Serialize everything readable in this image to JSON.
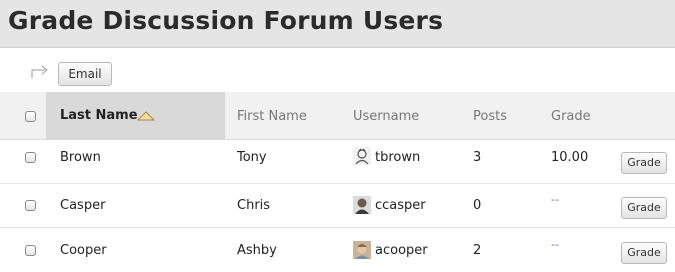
{
  "page": {
    "title": "Grade Discussion Forum Users"
  },
  "toolbar": {
    "email_label": "Email"
  },
  "table": {
    "headers": {
      "last_name": "Last Name",
      "first_name": "First Name",
      "username": "Username",
      "posts": "Posts",
      "grade": "Grade"
    },
    "sort": {
      "column": "last_name",
      "direction": "ascending"
    },
    "rows": [
      {
        "last_name": "Brown",
        "first_name": "Tony",
        "username": "tbrown",
        "avatar_icon": "user-avatar-sketch-icon",
        "posts": "3",
        "grade": "10.00",
        "action": "Grade"
      },
      {
        "last_name": "Casper",
        "first_name": "Chris",
        "username": "ccasper",
        "avatar_icon": "user-avatar-photo-icon",
        "posts": "0",
        "grade": "--",
        "action": "Grade"
      },
      {
        "last_name": "Cooper",
        "first_name": "Ashby",
        "username": "acooper",
        "avatar_icon": "user-avatar-photo-icon",
        "posts": "2",
        "grade": "--",
        "action": "Grade"
      }
    ]
  },
  "colors": {
    "title_bar": "#e5e5e5",
    "header_row": "#f1f1f1",
    "sorted_header": "#d9d9d9",
    "empty_grade": "#5a78a8"
  }
}
